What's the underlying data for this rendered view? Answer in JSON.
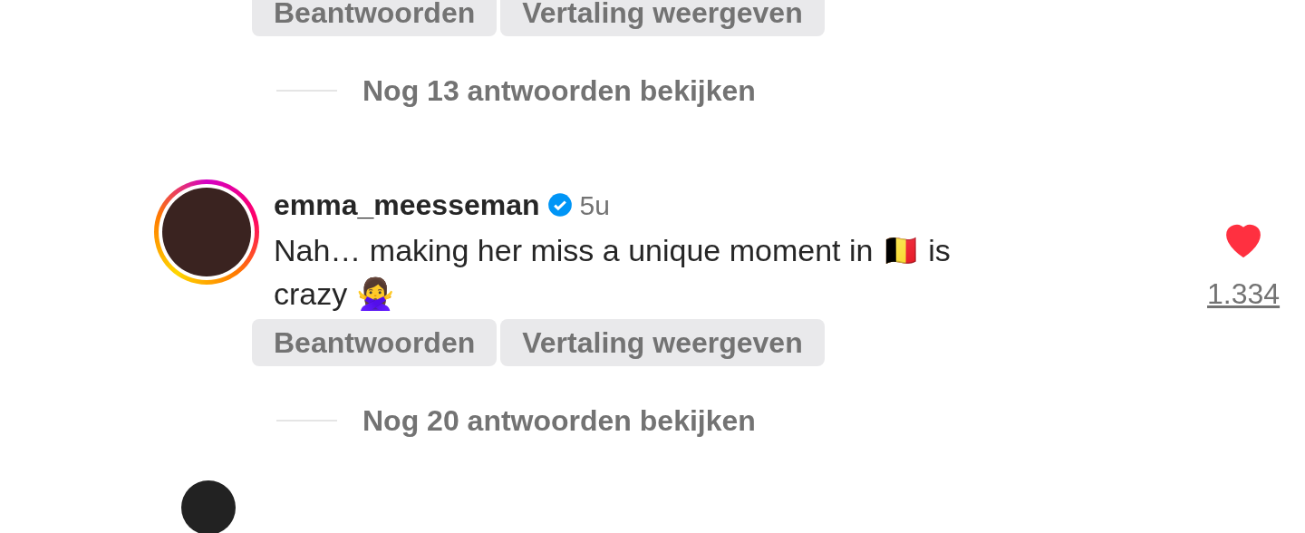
{
  "top_comment_actions": [
    "Beantwoorden",
    "Vertaling weergeven"
  ],
  "top_replies_link": "Nog 13 antwoorden bekijken",
  "comment": {
    "username": "emma_meesseman",
    "verified": true,
    "time": "5u",
    "text": "Nah… making her miss a unique moment in 🇧🇪 is crazy 🙅‍♀️",
    "liked": true,
    "like_count": "1.334",
    "actions": [
      "Beantwoorden",
      "Vertaling weergeven"
    ],
    "replies_link": "Nog 20 antwoorden bekijken"
  }
}
